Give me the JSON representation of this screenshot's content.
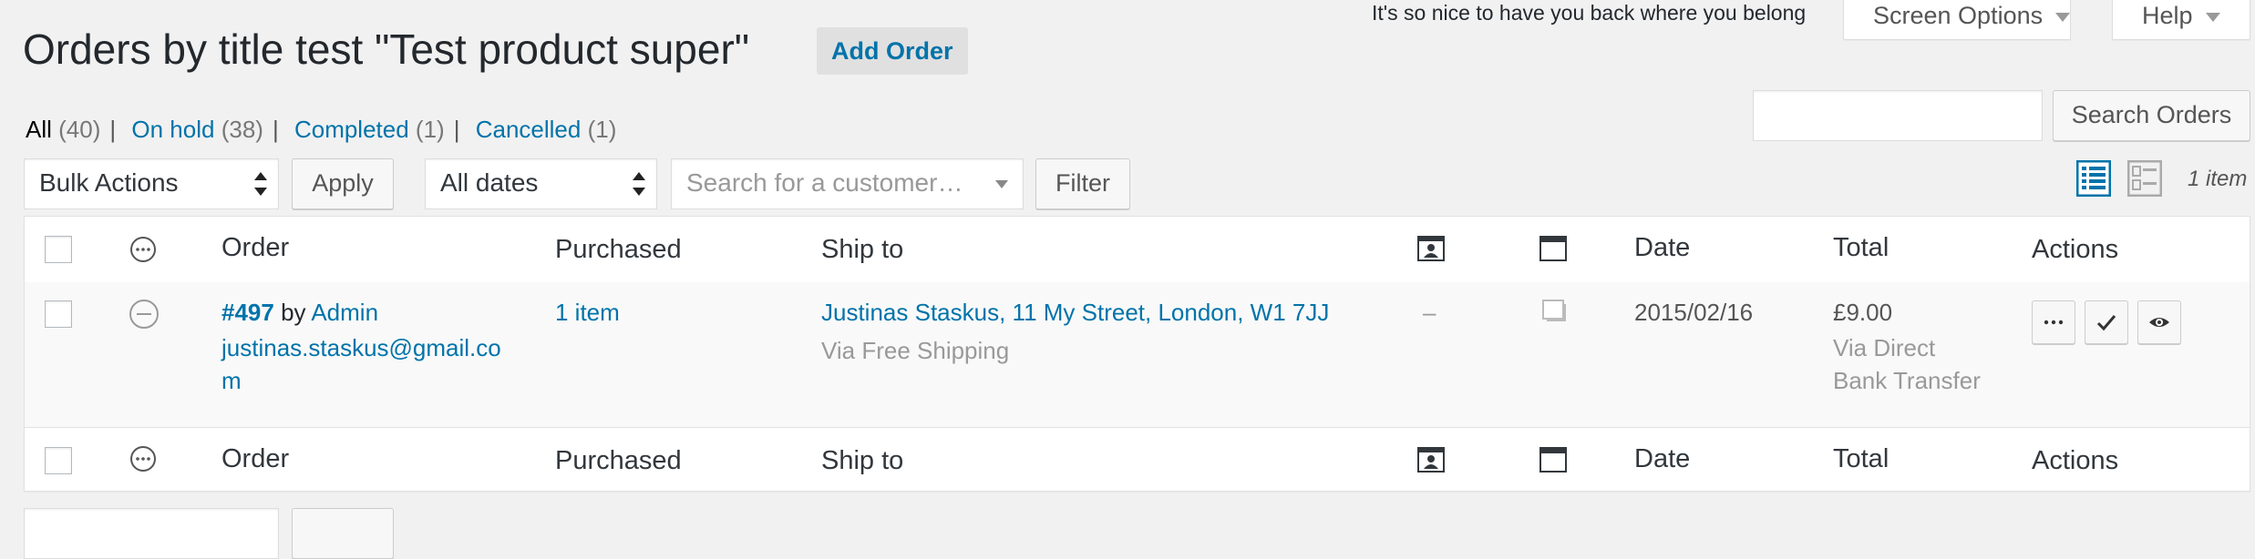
{
  "header": {
    "title": "Orders by title test \"Test product super\"",
    "add_order": "Add Order",
    "greeting": "It's so nice to have you back where you belong",
    "screen_options": "Screen Options",
    "help": "Help"
  },
  "status_links": [
    {
      "label": "All",
      "count": "(40)"
    },
    {
      "label": "On hold",
      "count": "(38)"
    },
    {
      "label": "Completed",
      "count": "(1)"
    },
    {
      "label": "Cancelled",
      "count": "(1)"
    }
  ],
  "search": {
    "value": "",
    "button": "Search Orders"
  },
  "tablenav": {
    "bulk_actions": "Bulk Actions",
    "apply": "Apply",
    "dates": "All dates",
    "customer_placeholder": "Search for a customer…",
    "filter": "Filter",
    "item_count": "1 item"
  },
  "columns": {
    "order": "Order",
    "purchased": "Purchased",
    "ship_to": "Ship to",
    "date": "Date",
    "total": "Total",
    "actions": "Actions"
  },
  "icons": {
    "status_column": "ellipsis-circle-icon",
    "billing_column": "id-card-icon",
    "notes_column": "window-icon",
    "row_status": "minus-circle-icon",
    "row_notes": "note-icon",
    "view_list": "list-view-icon",
    "view_excerpt": "excerpt-view-icon",
    "action_processing": "ellipsis-icon",
    "action_complete": "check-icon",
    "action_view": "eye-icon"
  },
  "orders": [
    {
      "number": "#497",
      "by": "by",
      "customer": "Admin",
      "email_line1": "justinas.staskus@gmail.co",
      "email_line2": "m",
      "purchased": "1 item",
      "ship_to": "Justinas Staskus, 11 My Street, London, W1 7JJ",
      "ship_method": "Via Free Shipping",
      "billing": "–",
      "date": "2015/02/16",
      "total": "£9.00",
      "payment_line1": "Via Direct",
      "payment_line2": "Bank Transfer"
    }
  ],
  "colors": {
    "link": "#0073aa",
    "text": "#23282d",
    "muted": "#999999",
    "background": "#f1f1f1"
  }
}
